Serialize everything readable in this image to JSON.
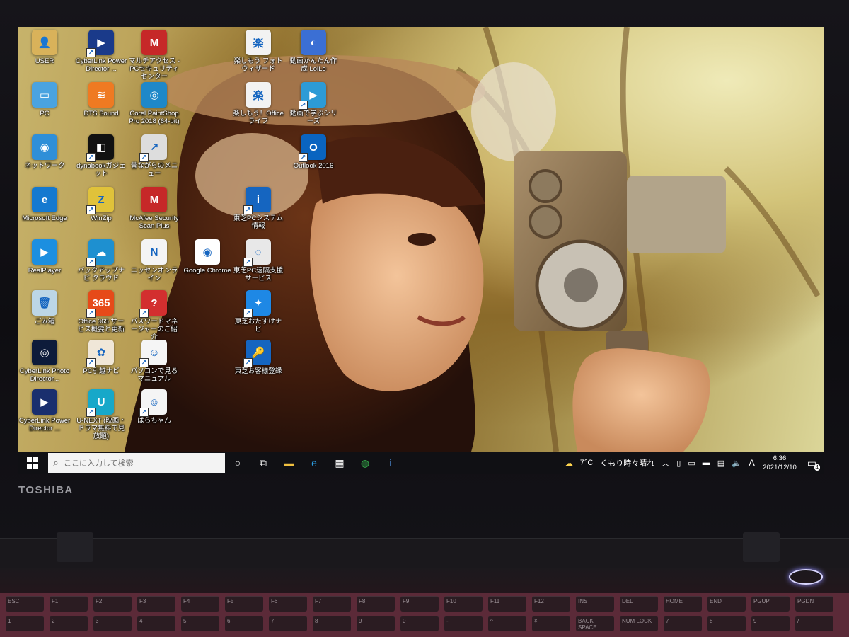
{
  "device": {
    "brand": "TOSHIBA"
  },
  "desktop_icons": [
    {
      "label": "USER",
      "color": "#d9b25a",
      "glyph": "folder-user-icon",
      "sym": "👤",
      "shortcut": false
    },
    {
      "label": "CyberLink PowerDirector ...",
      "color": "#1a3a8a",
      "glyph": "powerdirector-icon",
      "sym": "▶",
      "shortcut": true
    },
    {
      "label": "マルチアクセス - PCセキュリティセンター",
      "color": "#c62828",
      "glyph": "mcafee-icon",
      "sym": "M",
      "shortcut": false
    },
    {
      "label": "楽しもう フォトウィザード",
      "color": "#f2f2f2",
      "glyph": "photo-wizard-icon",
      "sym": "楽",
      "shortcut": false
    },
    {
      "label": "動画かんたん作成 LoiLo",
      "color": "#3b6fd4",
      "glyph": "loilo-icon",
      "sym": "◐",
      "shortcut": false
    },
    {
      "label": "PC",
      "color": "#4aa3e0",
      "glyph": "this-pc-icon",
      "sym": "▭",
      "shortcut": false
    },
    {
      "label": "DTS Sound",
      "color": "#ef7a22",
      "glyph": "dts-sound-icon",
      "sym": "≋",
      "shortcut": false
    },
    {
      "label": "Corel PaintShop Pro 2018 (64-bit)",
      "color": "#1e88c8",
      "glyph": "paintshop-icon",
      "sym": "◎",
      "shortcut": false
    },
    {
      "label": "楽しもう！Officeライフ",
      "color": "#f2f2f2",
      "glyph": "office-life-icon",
      "sym": "楽",
      "shortcut": false
    },
    {
      "label": "動画で学ぶシリーズ",
      "color": "#2d9bd6",
      "glyph": "video-learning-icon",
      "sym": "▶",
      "shortcut": true
    },
    {
      "label": "ネットワーク",
      "color": "#2f8fd8",
      "glyph": "network-icon",
      "sym": "◉",
      "shortcut": false
    },
    {
      "label": "dynabookガジェット",
      "color": "#111111",
      "glyph": "dynabook-gadget-icon",
      "sym": "◧",
      "shortcut": true
    },
    {
      "label": "昔ながらのメニュー",
      "color": "#dddddd",
      "glyph": "classic-menu-icon",
      "sym": "↗",
      "shortcut": true
    },
    {
      "label": "Outlook 2016",
      "color": "#0a64c0",
      "glyph": "outlook-icon",
      "sym": "O",
      "shortcut": true
    },
    {
      "label": "Microsoft Edge",
      "color": "#1479d0",
      "glyph": "edge-icon",
      "sym": "e",
      "shortcut": false
    },
    {
      "label": "WinZip",
      "color": "#e0c23a",
      "glyph": "winzip-icon",
      "sym": "Z",
      "shortcut": true
    },
    {
      "label": "McAfee Security Scan Plus",
      "color": "#c62828",
      "glyph": "mcafee-scan-icon",
      "sym": "M",
      "shortcut": false
    },
    {
      "label": "東芝PCシステム情報",
      "color": "#1565c0",
      "glyph": "toshiba-system-info-icon",
      "sym": "i",
      "shortcut": true
    },
    {
      "label": "RealPlayer",
      "color": "#1c8fe0",
      "glyph": "realplayer-icon",
      "sym": "▶",
      "shortcut": false
    },
    {
      "label": "バックアップナビ クラウド",
      "color": "#1e90d0",
      "glyph": "backup-navi-icon",
      "sym": "☁",
      "shortcut": true
    },
    {
      "label": "ニッセンオンライン",
      "color": "#f4f4f4",
      "glyph": "nissen-icon",
      "sym": "N",
      "shortcut": false
    },
    {
      "label": "Google Chrome",
      "color": "#ffffff",
      "glyph": "chrome-icon",
      "sym": "◉",
      "shortcut": false
    },
    {
      "label": "東芝PC遠隔支援サービス",
      "color": "#e8e8e8",
      "glyph": "remote-support-icon",
      "sym": "◌",
      "shortcut": true
    },
    {
      "label": "ごみ箱",
      "color": "#bcd6e6",
      "glyph": "recycle-bin-icon",
      "sym": "🗑",
      "shortcut": false
    },
    {
      "label": "Office 365 サービス概要と更新",
      "color": "#e64a19",
      "glyph": "office365-icon",
      "sym": "365",
      "shortcut": true
    },
    {
      "label": "パスワードマネージャーのご紹介",
      "color": "#d32f2f",
      "glyph": "password-manager-icon",
      "sym": "?",
      "shortcut": true
    },
    {
      "label": "東芝おたすけナビ",
      "color": "#1e88e5",
      "glyph": "help-navi-icon",
      "sym": "✦",
      "shortcut": true
    },
    {
      "label": "CyberLink PhotoDirector...",
      "color": "#0d1b3a",
      "glyph": "photodirector-icon",
      "sym": "◎",
      "shortcut": false
    },
    {
      "label": "PC引越ナビ",
      "color": "#f0e7d8",
      "glyph": "pc-moving-navi-icon",
      "sym": "✿",
      "shortcut": true
    },
    {
      "label": "パソコンで見るマニュアル",
      "color": "#f5f5f5",
      "glyph": "manual-icon",
      "sym": "☺",
      "shortcut": true
    },
    {
      "label": "東芝お客様登録",
      "color": "#1565c0",
      "glyph": "customer-registration-icon",
      "sym": "🔑",
      "shortcut": true
    },
    {
      "label": "CyberLink PowerDirector ...",
      "color": "#1a2f6e",
      "glyph": "powerdirector-icon",
      "sym": "▶",
      "shortcut": false
    },
    {
      "label": "U-NEXT (映画・ドラマ無料で見放題)",
      "color": "#17a8c9",
      "glyph": "u-next-icon",
      "sym": "U",
      "shortcut": true
    },
    {
      "label": "ぱらちゃん",
      "color": "#f5f5f5",
      "glyph": "parachan-icon",
      "sym": "☺",
      "shortcut": true
    }
  ],
  "taskbar": {
    "search_placeholder": "ここに入力して検索",
    "pinned": [
      {
        "name": "cortana-icon",
        "sym": "○"
      },
      {
        "name": "task-view-icon",
        "sym": "⧉"
      },
      {
        "name": "file-explorer-icon",
        "sym": "▬"
      },
      {
        "name": "edge-taskbar-icon",
        "sym": "e"
      },
      {
        "name": "store-icon",
        "sym": "▦"
      },
      {
        "name": "app-taskbar-icon",
        "sym": "◍"
      },
      {
        "name": "info-taskbar-icon",
        "sym": "i"
      }
    ],
    "weather_temp": "7°C",
    "weather_text": "くもり時々晴れ",
    "ime_mode": "A",
    "time": "6:36",
    "date": "2021/12/10",
    "notification_count": "4"
  },
  "keyboard": {
    "keys": [
      "ESC",
      "F1",
      "F2",
      "F3",
      "F4",
      "F5",
      "F6",
      "F7",
      "F8",
      "F9",
      "F10",
      "F11",
      "F12",
      "INS",
      "DEL",
      "HOME",
      "END",
      "PGUP",
      "PGDN"
    ],
    "row2": [
      "1",
      "2",
      "3",
      "4",
      "5",
      "6",
      "7",
      "8",
      "9",
      "0",
      "-",
      "^",
      "¥",
      "BACK SPACE",
      "NUM LOCK",
      "7",
      "8",
      "9",
      "/"
    ]
  }
}
